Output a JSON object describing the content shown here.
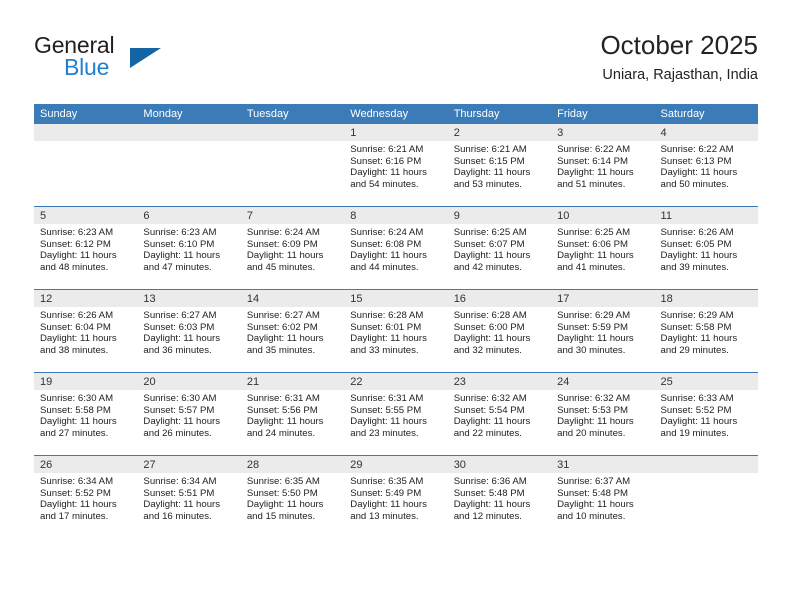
{
  "brand": {
    "name_top": "General",
    "name_bottom": "Blue",
    "accent_color": "#1464a5",
    "blue_text_color": "#1f7fd0"
  },
  "header": {
    "title": "October 2025",
    "location": "Uniara, Rajasthan, India"
  },
  "theme": {
    "header_blue": "#3b7cb8",
    "day_band_gray": "#ebebeb",
    "text": "#222222"
  },
  "weekdays": [
    "Sunday",
    "Monday",
    "Tuesday",
    "Wednesday",
    "Thursday",
    "Friday",
    "Saturday"
  ],
  "weeks": [
    [
      {
        "day": "",
        "sunrise": "",
        "sunset": "",
        "daylight_line1": "",
        "daylight_line2": ""
      },
      {
        "day": "",
        "sunrise": "",
        "sunset": "",
        "daylight_line1": "",
        "daylight_line2": ""
      },
      {
        "day": "",
        "sunrise": "",
        "sunset": "",
        "daylight_line1": "",
        "daylight_line2": ""
      },
      {
        "day": "1",
        "sunrise": "Sunrise: 6:21 AM",
        "sunset": "Sunset: 6:16 PM",
        "daylight_line1": "Daylight: 11 hours",
        "daylight_line2": "and 54 minutes."
      },
      {
        "day": "2",
        "sunrise": "Sunrise: 6:21 AM",
        "sunset": "Sunset: 6:15 PM",
        "daylight_line1": "Daylight: 11 hours",
        "daylight_line2": "and 53 minutes."
      },
      {
        "day": "3",
        "sunrise": "Sunrise: 6:22 AM",
        "sunset": "Sunset: 6:14 PM",
        "daylight_line1": "Daylight: 11 hours",
        "daylight_line2": "and 51 minutes."
      },
      {
        "day": "4",
        "sunrise": "Sunrise: 6:22 AM",
        "sunset": "Sunset: 6:13 PM",
        "daylight_line1": "Daylight: 11 hours",
        "daylight_line2": "and 50 minutes."
      }
    ],
    [
      {
        "day": "5",
        "sunrise": "Sunrise: 6:23 AM",
        "sunset": "Sunset: 6:12 PM",
        "daylight_line1": "Daylight: 11 hours",
        "daylight_line2": "and 48 minutes."
      },
      {
        "day": "6",
        "sunrise": "Sunrise: 6:23 AM",
        "sunset": "Sunset: 6:10 PM",
        "daylight_line1": "Daylight: 11 hours",
        "daylight_line2": "and 47 minutes."
      },
      {
        "day": "7",
        "sunrise": "Sunrise: 6:24 AM",
        "sunset": "Sunset: 6:09 PM",
        "daylight_line1": "Daylight: 11 hours",
        "daylight_line2": "and 45 minutes."
      },
      {
        "day": "8",
        "sunrise": "Sunrise: 6:24 AM",
        "sunset": "Sunset: 6:08 PM",
        "daylight_line1": "Daylight: 11 hours",
        "daylight_line2": "and 44 minutes."
      },
      {
        "day": "9",
        "sunrise": "Sunrise: 6:25 AM",
        "sunset": "Sunset: 6:07 PM",
        "daylight_line1": "Daylight: 11 hours",
        "daylight_line2": "and 42 minutes."
      },
      {
        "day": "10",
        "sunrise": "Sunrise: 6:25 AM",
        "sunset": "Sunset: 6:06 PM",
        "daylight_line1": "Daylight: 11 hours",
        "daylight_line2": "and 41 minutes."
      },
      {
        "day": "11",
        "sunrise": "Sunrise: 6:26 AM",
        "sunset": "Sunset: 6:05 PM",
        "daylight_line1": "Daylight: 11 hours",
        "daylight_line2": "and 39 minutes."
      }
    ],
    [
      {
        "day": "12",
        "sunrise": "Sunrise: 6:26 AM",
        "sunset": "Sunset: 6:04 PM",
        "daylight_line1": "Daylight: 11 hours",
        "daylight_line2": "and 38 minutes."
      },
      {
        "day": "13",
        "sunrise": "Sunrise: 6:27 AM",
        "sunset": "Sunset: 6:03 PM",
        "daylight_line1": "Daylight: 11 hours",
        "daylight_line2": "and 36 minutes."
      },
      {
        "day": "14",
        "sunrise": "Sunrise: 6:27 AM",
        "sunset": "Sunset: 6:02 PM",
        "daylight_line1": "Daylight: 11 hours",
        "daylight_line2": "and 35 minutes."
      },
      {
        "day": "15",
        "sunrise": "Sunrise: 6:28 AM",
        "sunset": "Sunset: 6:01 PM",
        "daylight_line1": "Daylight: 11 hours",
        "daylight_line2": "and 33 minutes."
      },
      {
        "day": "16",
        "sunrise": "Sunrise: 6:28 AM",
        "sunset": "Sunset: 6:00 PM",
        "daylight_line1": "Daylight: 11 hours",
        "daylight_line2": "and 32 minutes."
      },
      {
        "day": "17",
        "sunrise": "Sunrise: 6:29 AM",
        "sunset": "Sunset: 5:59 PM",
        "daylight_line1": "Daylight: 11 hours",
        "daylight_line2": "and 30 minutes."
      },
      {
        "day": "18",
        "sunrise": "Sunrise: 6:29 AM",
        "sunset": "Sunset: 5:58 PM",
        "daylight_line1": "Daylight: 11 hours",
        "daylight_line2": "and 29 minutes."
      }
    ],
    [
      {
        "day": "19",
        "sunrise": "Sunrise: 6:30 AM",
        "sunset": "Sunset: 5:58 PM",
        "daylight_line1": "Daylight: 11 hours",
        "daylight_line2": "and 27 minutes."
      },
      {
        "day": "20",
        "sunrise": "Sunrise: 6:30 AM",
        "sunset": "Sunset: 5:57 PM",
        "daylight_line1": "Daylight: 11 hours",
        "daylight_line2": "and 26 minutes."
      },
      {
        "day": "21",
        "sunrise": "Sunrise: 6:31 AM",
        "sunset": "Sunset: 5:56 PM",
        "daylight_line1": "Daylight: 11 hours",
        "daylight_line2": "and 24 minutes."
      },
      {
        "day": "22",
        "sunrise": "Sunrise: 6:31 AM",
        "sunset": "Sunset: 5:55 PM",
        "daylight_line1": "Daylight: 11 hours",
        "daylight_line2": "and 23 minutes."
      },
      {
        "day": "23",
        "sunrise": "Sunrise: 6:32 AM",
        "sunset": "Sunset: 5:54 PM",
        "daylight_line1": "Daylight: 11 hours",
        "daylight_line2": "and 22 minutes."
      },
      {
        "day": "24",
        "sunrise": "Sunrise: 6:32 AM",
        "sunset": "Sunset: 5:53 PM",
        "daylight_line1": "Daylight: 11 hours",
        "daylight_line2": "and 20 minutes."
      },
      {
        "day": "25",
        "sunrise": "Sunrise: 6:33 AM",
        "sunset": "Sunset: 5:52 PM",
        "daylight_line1": "Daylight: 11 hours",
        "daylight_line2": "and 19 minutes."
      }
    ],
    [
      {
        "day": "26",
        "sunrise": "Sunrise: 6:34 AM",
        "sunset": "Sunset: 5:52 PM",
        "daylight_line1": "Daylight: 11 hours",
        "daylight_line2": "and 17 minutes."
      },
      {
        "day": "27",
        "sunrise": "Sunrise: 6:34 AM",
        "sunset": "Sunset: 5:51 PM",
        "daylight_line1": "Daylight: 11 hours",
        "daylight_line2": "and 16 minutes."
      },
      {
        "day": "28",
        "sunrise": "Sunrise: 6:35 AM",
        "sunset": "Sunset: 5:50 PM",
        "daylight_line1": "Daylight: 11 hours",
        "daylight_line2": "and 15 minutes."
      },
      {
        "day": "29",
        "sunrise": "Sunrise: 6:35 AM",
        "sunset": "Sunset: 5:49 PM",
        "daylight_line1": "Daylight: 11 hours",
        "daylight_line2": "and 13 minutes."
      },
      {
        "day": "30",
        "sunrise": "Sunrise: 6:36 AM",
        "sunset": "Sunset: 5:48 PM",
        "daylight_line1": "Daylight: 11 hours",
        "daylight_line2": "and 12 minutes."
      },
      {
        "day": "31",
        "sunrise": "Sunrise: 6:37 AM",
        "sunset": "Sunset: 5:48 PM",
        "daylight_line1": "Daylight: 11 hours",
        "daylight_line2": "and 10 minutes."
      },
      {
        "day": "",
        "sunrise": "",
        "sunset": "",
        "daylight_line1": "",
        "daylight_line2": ""
      }
    ]
  ]
}
